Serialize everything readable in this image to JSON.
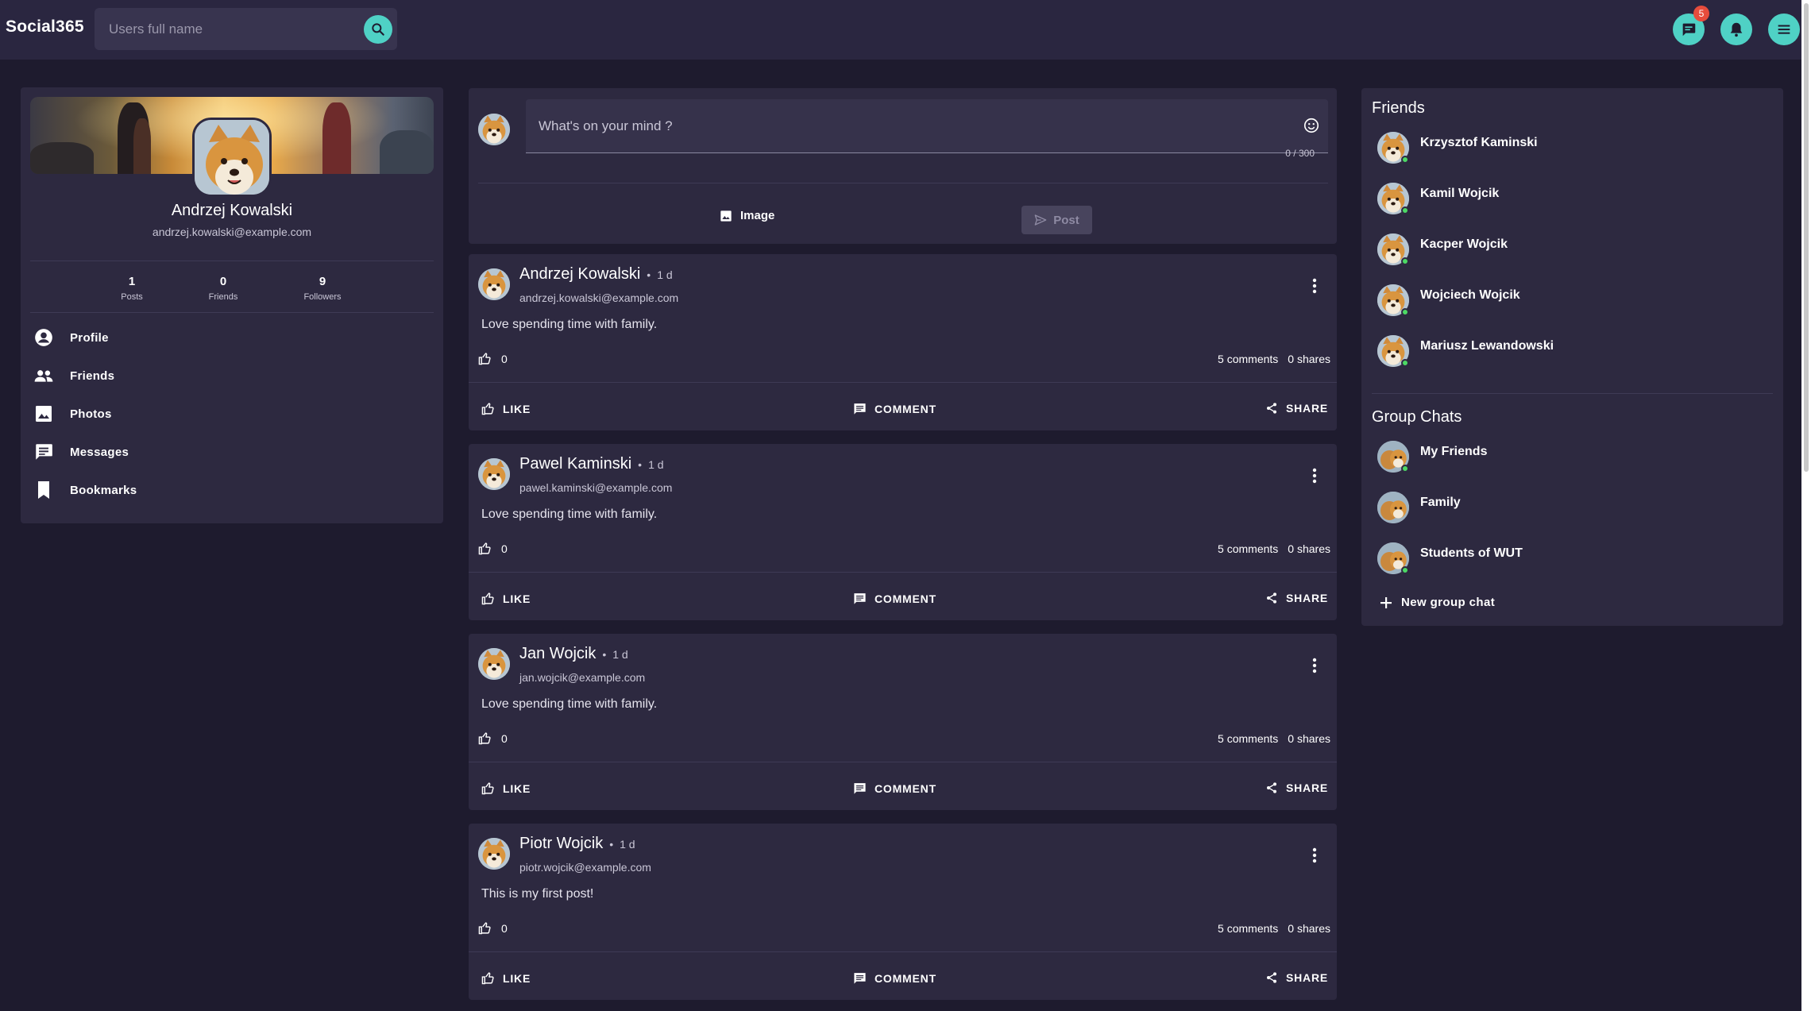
{
  "app": {
    "brand": "Social365"
  },
  "search": {
    "placeholder": "Users full name"
  },
  "header": {
    "messages_badge": "5"
  },
  "profile": {
    "name": "Andrzej Kowalski",
    "email": "andrzej.kowalski@example.com",
    "stats": [
      {
        "value": "1",
        "label": "Posts"
      },
      {
        "value": "0",
        "label": "Friends"
      },
      {
        "value": "9",
        "label": "Followers"
      }
    ],
    "menu": [
      {
        "label": "Profile",
        "icon": "account-circle-icon"
      },
      {
        "label": "Friends",
        "icon": "people-icon"
      },
      {
        "label": "Photos",
        "icon": "image-icon"
      },
      {
        "label": "Messages",
        "icon": "chat-icon"
      },
      {
        "label": "Bookmarks",
        "icon": "bookmark-icon"
      }
    ]
  },
  "composer": {
    "placeholder": "What's on your mind ?",
    "counter": "0 / 300",
    "image_label": "Image",
    "post_label": "Post"
  },
  "posts": [
    {
      "author": "Andrzej Kowalski",
      "time": "1 d",
      "email": "andrzej.kowalski@example.com",
      "text": "Love spending time with family.",
      "likes": "0",
      "comments": "5 comments",
      "shares": "0 shares"
    },
    {
      "author": "Pawel Kaminski",
      "time": "1 d",
      "email": "pawel.kaminski@example.com",
      "text": "Love spending time with family.",
      "likes": "0",
      "comments": "5 comments",
      "shares": "0 shares"
    },
    {
      "author": "Jan Wojcik",
      "time": "1 d",
      "email": "jan.wojcik@example.com",
      "text": "Love spending time with family.",
      "likes": "0",
      "comments": "5 comments",
      "shares": "0 shares"
    },
    {
      "author": "Piotr Wojcik",
      "time": "1 d",
      "email": "piotr.wojcik@example.com",
      "text": "This is my first post!",
      "likes": "0",
      "comments": "5 comments",
      "shares": "0 shares"
    }
  ],
  "post_actions": {
    "like": "LIKE",
    "comment": "COMMENT",
    "share": "SHARE",
    "dot": "•"
  },
  "sidebar": {
    "friends_title": "Friends",
    "friends": [
      {
        "name": "Krzysztof Kaminski",
        "online": true
      },
      {
        "name": "Kamil Wojcik",
        "online": true
      },
      {
        "name": "Kacper Wojcik",
        "online": true
      },
      {
        "name": "Wojciech Wojcik",
        "online": true
      },
      {
        "name": "Mariusz Lewandowski",
        "online": true
      }
    ],
    "groups_title": "Group Chats",
    "groups": [
      {
        "name": "My Friends",
        "online": true
      },
      {
        "name": "Family",
        "online": false
      },
      {
        "name": "Students of WUT",
        "online": true
      }
    ],
    "new_group_label": "New group chat"
  },
  "colors": {
    "background": "#1e1b2e",
    "topbar": "#2a2640",
    "card": "#2d2940",
    "accent": "#4fd1c5",
    "badge": "#e74c3c",
    "online": "#4cd964"
  }
}
